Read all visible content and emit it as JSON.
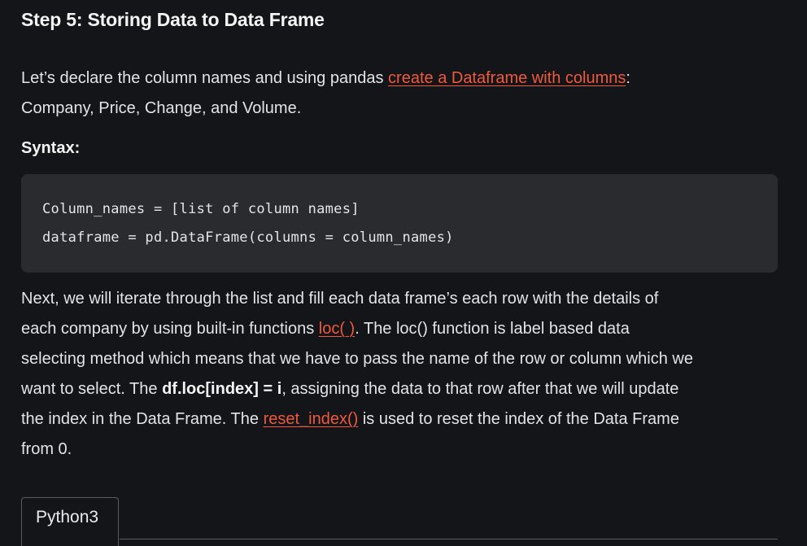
{
  "heading": "Step 5: Storing Data to Data Frame",
  "intro": {
    "line1_before": "Let’s declare the column names and using pandas ",
    "line1_link": "create a Dataframe with columns",
    "line1_after": ":",
    "line2": "Company, Price, Change, and Volume."
  },
  "syntax_label": "Syntax:",
  "code": {
    "line1": "Column_names = [list of column names]",
    "line2": "dataframe = pd.DataFrame(columns = column_names)"
  },
  "body": {
    "line1": "Next, we will iterate through the list and fill each data frame’s each row with the details of",
    "line2_before": "each company by using built-in functions ",
    "line2_link": "loc( )",
    "line2_after": ". The loc() function is label based data",
    "line3": "selecting method which means that we have to pass the name of the row or column which we",
    "line4_before": "want to select. The ",
    "line4_bold": "df.loc[index] = i",
    "line4_after": ", assigning the data to that row after that we will update",
    "line5_before": "the index in the Data Frame. The ",
    "line5_link": "reset_index()",
    "line5_after": " is used to reset the index of the Data Frame",
    "line6": "from 0."
  },
  "tabs": [
    {
      "label": "Python3"
    }
  ],
  "colors": {
    "background": "#141519",
    "text": "#e3e4e6",
    "link": "#f0593b",
    "code_bg": "#2a2b2f"
  }
}
